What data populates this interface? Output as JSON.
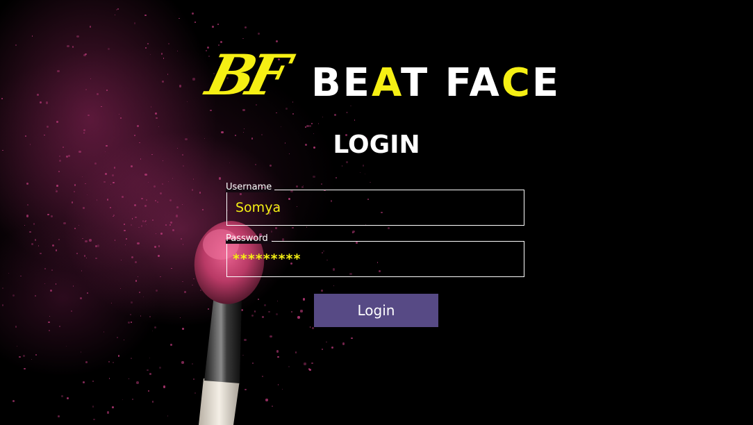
{
  "brand": {
    "monogram": "BF",
    "word_parts": [
      "BE",
      "A",
      "T F",
      "A",
      "C",
      "E"
    ],
    "accent_color": "#f5ef14"
  },
  "form": {
    "title": "LOGIN",
    "username": {
      "label": "Username",
      "value": "Somya"
    },
    "password": {
      "label": "Password",
      "value": "*********"
    },
    "submit_label": "Login",
    "button_color": "#574a85"
  },
  "background": {
    "icon": "makeup-brush-icon",
    "powder_color": "#c13c7e"
  }
}
